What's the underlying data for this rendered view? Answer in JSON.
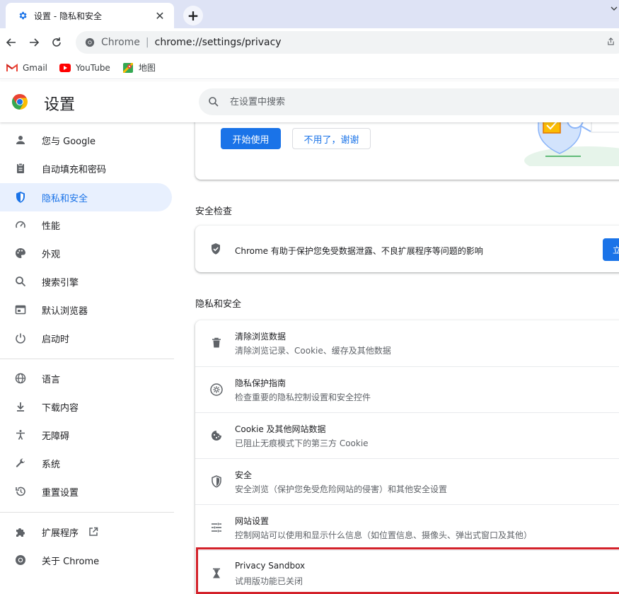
{
  "browser": {
    "tab": {
      "title": "设置 - 隐私和安全",
      "close": "✕"
    },
    "newtab": "+",
    "omnibox": {
      "chrome_label": "Chrome",
      "separator": "|",
      "url": "chrome://settings/privacy"
    },
    "bookmarks": [
      {
        "label": "Gmail",
        "icon": "gmail-icon"
      },
      {
        "label": "YouTube",
        "icon": "youtube-icon"
      },
      {
        "label": "地图",
        "icon": "maps-icon"
      }
    ]
  },
  "settings": {
    "title": "设置",
    "search_placeholder": "在设置中搜索"
  },
  "sidebar": {
    "items": [
      {
        "label": "您与 Google",
        "icon": "person-icon"
      },
      {
        "label": "自动填充和密码",
        "icon": "clipboard-icon"
      },
      {
        "label": "隐私和安全",
        "icon": "shield-icon",
        "active": true
      },
      {
        "label": "性能",
        "icon": "speedometer-icon"
      },
      {
        "label": "外观",
        "icon": "palette-icon"
      },
      {
        "label": "搜索引擎",
        "icon": "search-icon"
      },
      {
        "label": "默认浏览器",
        "icon": "browser-icon"
      },
      {
        "label": "启动时",
        "icon": "power-icon"
      },
      {
        "label": "语言",
        "icon": "globe-icon"
      },
      {
        "label": "下载内容",
        "icon": "download-icon"
      },
      {
        "label": "无障碍",
        "icon": "accessibility-icon"
      },
      {
        "label": "系统",
        "icon": "wrench-icon"
      },
      {
        "label": "重置设置",
        "icon": "reset-icon"
      },
      {
        "label": "扩展程序",
        "icon": "puzzle-icon"
      },
      {
        "label": "关于 Chrome",
        "icon": "chrome-icon"
      }
    ]
  },
  "main": {
    "promo": {
      "start_button": "开始使用",
      "decline_button": "不用了，谢谢"
    },
    "safety_check": {
      "heading": "安全检查",
      "text": "Chrome 有助于保护您免受数据泄露、不良扩展程序等问题的影响",
      "button": "立"
    },
    "privacy": {
      "heading": "隐私和安全",
      "rows": [
        {
          "title": "清除浏览数据",
          "subtitle": "清除浏览记录、Cookie、缓存及其他数据",
          "icon": "trash-icon"
        },
        {
          "title": "隐私保护指南",
          "subtitle": "检查重要的隐私控制设置和安全控件",
          "icon": "compass-icon"
        },
        {
          "title": "Cookie 及其他网站数据",
          "subtitle": "已阻止无痕模式下的第三方 Cookie",
          "icon": "cookie-icon"
        },
        {
          "title": "安全",
          "subtitle": "安全浏览（保护您免受危险网站的侵害）和其他安全设置",
          "icon": "security-shield-icon"
        },
        {
          "title": "网站设置",
          "subtitle": "控制网站可以使用和显示什么信息（如位置信息、摄像头、弹出式窗口及其他）",
          "icon": "tune-icon"
        },
        {
          "title": "Privacy Sandbox",
          "subtitle": "试用版功能已关闭",
          "icon": "flask-icon"
        }
      ]
    }
  },
  "colors": {
    "accent": "#1a73e8",
    "highlight": "#d3212a",
    "tabstrip": "#dee3f5"
  }
}
